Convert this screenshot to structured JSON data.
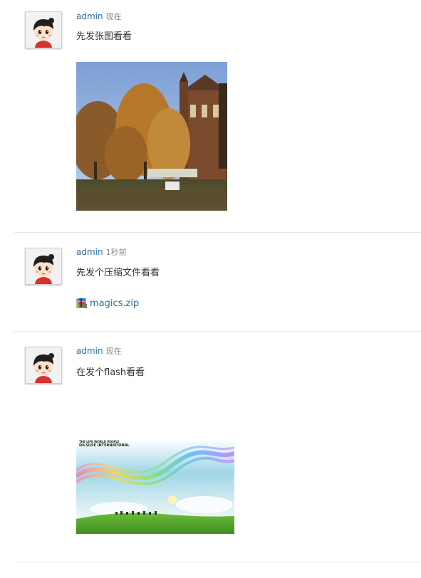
{
  "posts": [
    {
      "author": "admin",
      "time": "现在",
      "text": "先发张图看看",
      "attachment_type": "image"
    },
    {
      "author": "admin",
      "time": "1秒前",
      "text": "先发个压缩文件看看",
      "attachment_type": "file",
      "file_name": "magics.zip",
      "file_icon": "zip-archive-icon"
    },
    {
      "author": "admin",
      "time": "现在",
      "text": "在发个flash看看",
      "attachment_type": "flash",
      "flash_caption_line1": "THE LIFE WORLD PEOPLE",
      "flash_caption_line2": "DILSUSE INTERNATIONAL"
    }
  ],
  "colors": {
    "author_link": "#2c6b9a",
    "time_text": "#888888",
    "divider": "#e8e8e8"
  }
}
